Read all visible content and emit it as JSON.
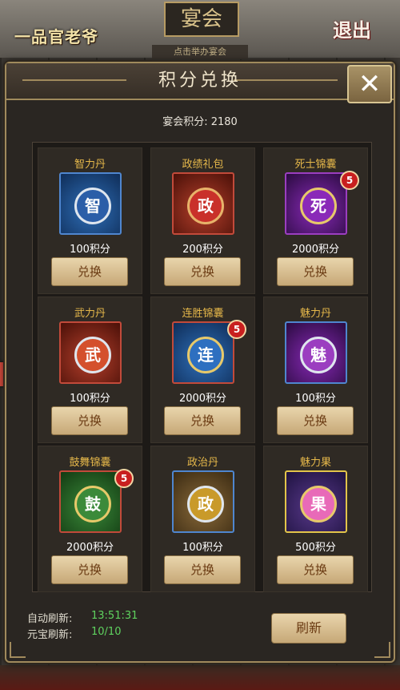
{
  "scene": {
    "game_logo": "一品官老爷",
    "feast_title": "宴会",
    "feast_subtitle": "点击举办宴会",
    "exit_label": "退出"
  },
  "dialog": {
    "title": "积分兑换",
    "close_label": "✕",
    "points_label": "宴会积分:",
    "points_value": "2180"
  },
  "items": [
    {
      "name": "智力丹",
      "price": "100积分",
      "badge": "",
      "color": "blue",
      "glyph": "智",
      "button": "兑换"
    },
    {
      "name": "政绩礼包",
      "price": "200积分",
      "badge": "",
      "color": "red",
      "glyph": "政",
      "button": "兑换"
    },
    {
      "name": "死士锦囊",
      "price": "2000积分",
      "badge": "5",
      "color": "purple",
      "glyph": "死",
      "button": "兑换"
    },
    {
      "name": "武力丹",
      "price": "100积分",
      "badge": "",
      "color": "red",
      "glyph": "武",
      "button": "兑换"
    },
    {
      "name": "连胜锦囊",
      "price": "2000积分",
      "badge": "5",
      "color": "blue",
      "glyph": "连",
      "button": "兑换"
    },
    {
      "name": "魅力丹",
      "price": "100积分",
      "badge": "",
      "color": "purple",
      "glyph": "魅",
      "button": "兑换"
    },
    {
      "name": "鼓舞锦囊",
      "price": "2000积分",
      "badge": "5",
      "color": "green",
      "glyph": "鼓",
      "button": "兑换"
    },
    {
      "name": "政治丹",
      "price": "100积分",
      "badge": "",
      "color": "blue",
      "glyph": "政",
      "button": "兑换"
    },
    {
      "name": "魅力果",
      "price": "500积分",
      "badge": "",
      "color": "gold",
      "glyph": "果",
      "button": "兑换"
    }
  ],
  "footer": {
    "auto_refresh_label": "自动刷新:",
    "auto_refresh_value": "13:51:31",
    "yuanbao_refresh_label": "元宝刷新:",
    "yuanbao_refresh_value": "10/10",
    "refresh_button": "刷新"
  },
  "colors": {
    "accent_gold": "#e6b84a",
    "timer_green": "#5fd35f",
    "button_text": "#6a3a12"
  }
}
